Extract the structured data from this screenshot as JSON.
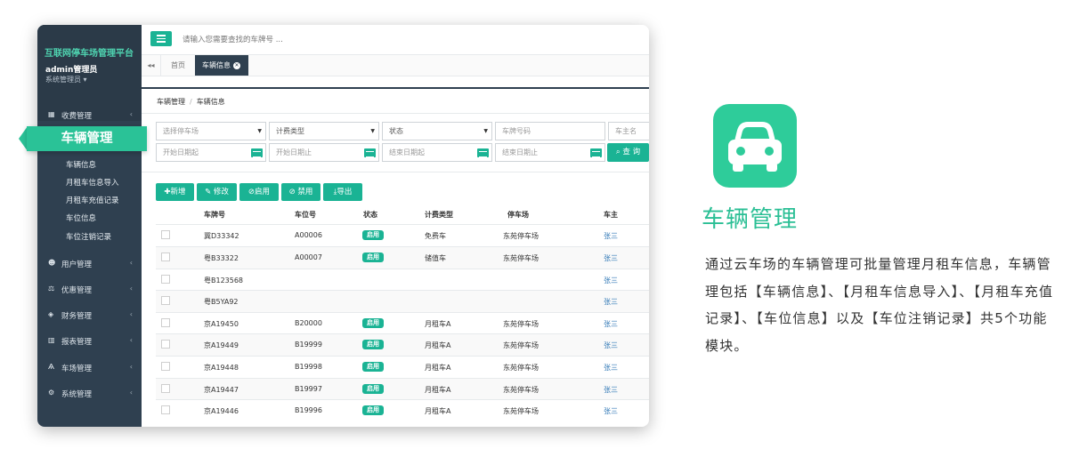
{
  "sidebar": {
    "brand_title": "互联网停车场管理平台",
    "user_name": "admin管理员",
    "user_role": "系统管理员 ▾",
    "nav": [
      {
        "label": "收费管理",
        "icon": "grid-icon"
      },
      {
        "label": "用户管理",
        "icon": "users-icon"
      },
      {
        "label": "优惠管理",
        "icon": "balance-icon"
      },
      {
        "label": "财务管理",
        "icon": "diamond-icon"
      },
      {
        "label": "报表管理",
        "icon": "bar-chart-icon"
      },
      {
        "label": "车场管理",
        "icon": "road-icon"
      },
      {
        "label": "系统管理",
        "icon": "gears-icon"
      }
    ],
    "callout": "车辆管理",
    "sub_items": [
      "车辆信息",
      "月租车信息导入",
      "月租车充值记录",
      "车位信息",
      "车位注销记录"
    ]
  },
  "topbar": {
    "search_placeholder": "请输入您需要查找的车牌号 ..."
  },
  "tabs": {
    "back": "◂◂",
    "home": "首页",
    "active": "车辆信息"
  },
  "breadcrumb": [
    "车辆管理",
    "车辆信息"
  ],
  "filters": {
    "row1": [
      {
        "text": "选择停车场",
        "type": "select",
        "ph": true
      },
      {
        "text": "计费类型",
        "type": "select",
        "ph": false
      },
      {
        "text": "状态",
        "type": "select",
        "ph": false
      },
      {
        "text": "车牌号码",
        "type": "text",
        "ph": true
      },
      {
        "text": "车主名",
        "type": "text",
        "ph": true
      }
    ],
    "row2": [
      {
        "text": "开始日期起",
        "type": "date"
      },
      {
        "text": "开始日期止",
        "type": "date"
      },
      {
        "text": "结束日期起",
        "type": "date"
      },
      {
        "text": "结束日期止",
        "type": "date"
      }
    ],
    "query": "查 询"
  },
  "actions": [
    {
      "label": "新增",
      "icon": "plus-icon"
    },
    {
      "label": "修改",
      "icon": "edit-icon"
    },
    {
      "label": "启用",
      "icon": "check-circle-icon"
    },
    {
      "label": "禁用",
      "icon": "ban-icon"
    },
    {
      "label": "导出",
      "icon": "download-icon"
    }
  ],
  "table": {
    "headers": [
      "车牌号",
      "车位号",
      "状态",
      "计费类型",
      "停车场",
      "车主"
    ],
    "rows": [
      {
        "plate": "冀D33342",
        "space": "A00006",
        "status": "启用",
        "billing": "免费车",
        "lot": "东苑停车场",
        "owner": "张三"
      },
      {
        "plate": "粤B33322",
        "space": "A00007",
        "status": "启用",
        "billing": "储值车",
        "lot": "东苑停车场",
        "owner": "张三"
      },
      {
        "plate": "粤B123568",
        "space": "",
        "status": "",
        "billing": "",
        "lot": "",
        "owner": "张三"
      },
      {
        "plate": "粤B5YA92",
        "space": "",
        "status": "",
        "billing": "",
        "lot": "",
        "owner": "张三"
      },
      {
        "plate": "京A19450",
        "space": "B20000",
        "status": "启用",
        "billing": "月租车A",
        "lot": "东苑停车场",
        "owner": "张三"
      },
      {
        "plate": "京A19449",
        "space": "B19999",
        "status": "启用",
        "billing": "月租车A",
        "lot": "东苑停车场",
        "owner": "张三"
      },
      {
        "plate": "京A19448",
        "space": "B19998",
        "status": "启用",
        "billing": "月租车A",
        "lot": "东苑停车场",
        "owner": "张三"
      },
      {
        "plate": "京A19447",
        "space": "B19997",
        "status": "启用",
        "billing": "月租车A",
        "lot": "东苑停车场",
        "owner": "张三"
      },
      {
        "plate": "京A19446",
        "space": "B19996",
        "status": "启用",
        "billing": "月租车A",
        "lot": "东苑停车场",
        "owner": "张三"
      }
    ]
  },
  "feature": {
    "title": "车辆管理",
    "icon": "car-icon",
    "description": "通过云车场的车辆管理可批量管理月租车信息，车辆管理包括【车辆信息】、【月租车信息导入】、【月租车充值记录】、【车位信息】以及【车位注销记录】共5个功能模块。"
  },
  "colors": {
    "accent": "#1ab394",
    "sidebar": "#2f4050",
    "callout": "#2ac297",
    "app_icon": "#2ecc9a"
  }
}
